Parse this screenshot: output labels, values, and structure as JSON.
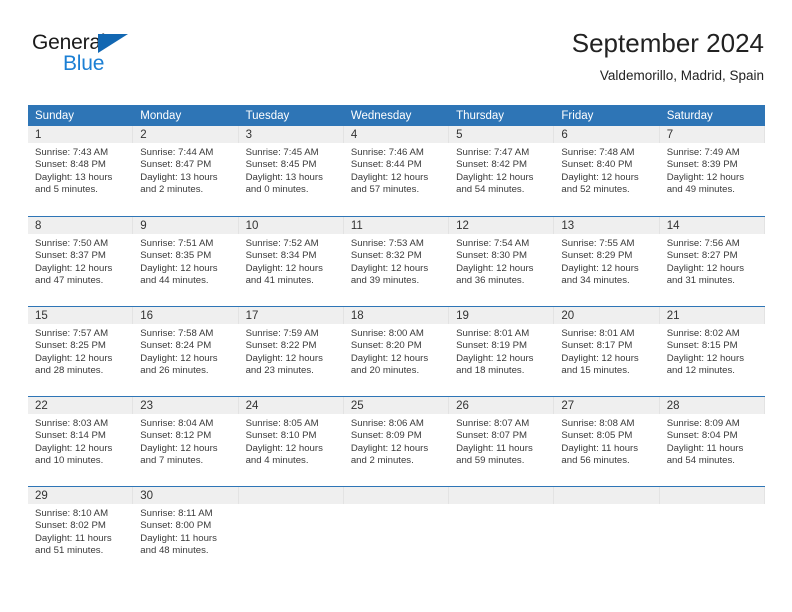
{
  "brand": {
    "name_top": "General",
    "name_bottom": "Blue",
    "flag_icon": "triangle-flag-icon",
    "color_blue": "#1b7fd4",
    "color_flag": "#1267b2"
  },
  "header": {
    "title": "September 2024",
    "subtitle": "Valdemorillo, Madrid, Spain"
  },
  "theme": {
    "header_blue": "#2e75b6",
    "band_gray": "#efefef",
    "text_dark": "#333333"
  },
  "weekday_headers": [
    "Sunday",
    "Monday",
    "Tuesday",
    "Wednesday",
    "Thursday",
    "Friday",
    "Saturday"
  ],
  "weeks": [
    [
      {
        "day": "1",
        "sunrise": "Sunrise: 7:43 AM",
        "sunset": "Sunset: 8:48 PM",
        "daylight_line1": "Daylight: 13 hours",
        "daylight_line2": "and 5 minutes."
      },
      {
        "day": "2",
        "sunrise": "Sunrise: 7:44 AM",
        "sunset": "Sunset: 8:47 PM",
        "daylight_line1": "Daylight: 13 hours",
        "daylight_line2": "and 2 minutes."
      },
      {
        "day": "3",
        "sunrise": "Sunrise: 7:45 AM",
        "sunset": "Sunset: 8:45 PM",
        "daylight_line1": "Daylight: 13 hours",
        "daylight_line2": "and 0 minutes."
      },
      {
        "day": "4",
        "sunrise": "Sunrise: 7:46 AM",
        "sunset": "Sunset: 8:44 PM",
        "daylight_line1": "Daylight: 12 hours",
        "daylight_line2": "and 57 minutes."
      },
      {
        "day": "5",
        "sunrise": "Sunrise: 7:47 AM",
        "sunset": "Sunset: 8:42 PM",
        "daylight_line1": "Daylight: 12 hours",
        "daylight_line2": "and 54 minutes."
      },
      {
        "day": "6",
        "sunrise": "Sunrise: 7:48 AM",
        "sunset": "Sunset: 8:40 PM",
        "daylight_line1": "Daylight: 12 hours",
        "daylight_line2": "and 52 minutes."
      },
      {
        "day": "7",
        "sunrise": "Sunrise: 7:49 AM",
        "sunset": "Sunset: 8:39 PM",
        "daylight_line1": "Daylight: 12 hours",
        "daylight_line2": "and 49 minutes."
      }
    ],
    [
      {
        "day": "8",
        "sunrise": "Sunrise: 7:50 AM",
        "sunset": "Sunset: 8:37 PM",
        "daylight_line1": "Daylight: 12 hours",
        "daylight_line2": "and 47 minutes."
      },
      {
        "day": "9",
        "sunrise": "Sunrise: 7:51 AM",
        "sunset": "Sunset: 8:35 PM",
        "daylight_line1": "Daylight: 12 hours",
        "daylight_line2": "and 44 minutes."
      },
      {
        "day": "10",
        "sunrise": "Sunrise: 7:52 AM",
        "sunset": "Sunset: 8:34 PM",
        "daylight_line1": "Daylight: 12 hours",
        "daylight_line2": "and 41 minutes."
      },
      {
        "day": "11",
        "sunrise": "Sunrise: 7:53 AM",
        "sunset": "Sunset: 8:32 PM",
        "daylight_line1": "Daylight: 12 hours",
        "daylight_line2": "and 39 minutes."
      },
      {
        "day": "12",
        "sunrise": "Sunrise: 7:54 AM",
        "sunset": "Sunset: 8:30 PM",
        "daylight_line1": "Daylight: 12 hours",
        "daylight_line2": "and 36 minutes."
      },
      {
        "day": "13",
        "sunrise": "Sunrise: 7:55 AM",
        "sunset": "Sunset: 8:29 PM",
        "daylight_line1": "Daylight: 12 hours",
        "daylight_line2": "and 34 minutes."
      },
      {
        "day": "14",
        "sunrise": "Sunrise: 7:56 AM",
        "sunset": "Sunset: 8:27 PM",
        "daylight_line1": "Daylight: 12 hours",
        "daylight_line2": "and 31 minutes."
      }
    ],
    [
      {
        "day": "15",
        "sunrise": "Sunrise: 7:57 AM",
        "sunset": "Sunset: 8:25 PM",
        "daylight_line1": "Daylight: 12 hours",
        "daylight_line2": "and 28 minutes."
      },
      {
        "day": "16",
        "sunrise": "Sunrise: 7:58 AM",
        "sunset": "Sunset: 8:24 PM",
        "daylight_line1": "Daylight: 12 hours",
        "daylight_line2": "and 26 minutes."
      },
      {
        "day": "17",
        "sunrise": "Sunrise: 7:59 AM",
        "sunset": "Sunset: 8:22 PM",
        "daylight_line1": "Daylight: 12 hours",
        "daylight_line2": "and 23 minutes."
      },
      {
        "day": "18",
        "sunrise": "Sunrise: 8:00 AM",
        "sunset": "Sunset: 8:20 PM",
        "daylight_line1": "Daylight: 12 hours",
        "daylight_line2": "and 20 minutes."
      },
      {
        "day": "19",
        "sunrise": "Sunrise: 8:01 AM",
        "sunset": "Sunset: 8:19 PM",
        "daylight_line1": "Daylight: 12 hours",
        "daylight_line2": "and 18 minutes."
      },
      {
        "day": "20",
        "sunrise": "Sunrise: 8:01 AM",
        "sunset": "Sunset: 8:17 PM",
        "daylight_line1": "Daylight: 12 hours",
        "daylight_line2": "and 15 minutes."
      },
      {
        "day": "21",
        "sunrise": "Sunrise: 8:02 AM",
        "sunset": "Sunset: 8:15 PM",
        "daylight_line1": "Daylight: 12 hours",
        "daylight_line2": "and 12 minutes."
      }
    ],
    [
      {
        "day": "22",
        "sunrise": "Sunrise: 8:03 AM",
        "sunset": "Sunset: 8:14 PM",
        "daylight_line1": "Daylight: 12 hours",
        "daylight_line2": "and 10 minutes."
      },
      {
        "day": "23",
        "sunrise": "Sunrise: 8:04 AM",
        "sunset": "Sunset: 8:12 PM",
        "daylight_line1": "Daylight: 12 hours",
        "daylight_line2": "and 7 minutes."
      },
      {
        "day": "24",
        "sunrise": "Sunrise: 8:05 AM",
        "sunset": "Sunset: 8:10 PM",
        "daylight_line1": "Daylight: 12 hours",
        "daylight_line2": "and 4 minutes."
      },
      {
        "day": "25",
        "sunrise": "Sunrise: 8:06 AM",
        "sunset": "Sunset: 8:09 PM",
        "daylight_line1": "Daylight: 12 hours",
        "daylight_line2": "and 2 minutes."
      },
      {
        "day": "26",
        "sunrise": "Sunrise: 8:07 AM",
        "sunset": "Sunset: 8:07 PM",
        "daylight_line1": "Daylight: 11 hours",
        "daylight_line2": "and 59 minutes."
      },
      {
        "day": "27",
        "sunrise": "Sunrise: 8:08 AM",
        "sunset": "Sunset: 8:05 PM",
        "daylight_line1": "Daylight: 11 hours",
        "daylight_line2": "and 56 minutes."
      },
      {
        "day": "28",
        "sunrise": "Sunrise: 8:09 AM",
        "sunset": "Sunset: 8:04 PM",
        "daylight_line1": "Daylight: 11 hours",
        "daylight_line2": "and 54 minutes."
      }
    ],
    [
      {
        "day": "29",
        "sunrise": "Sunrise: 8:10 AM",
        "sunset": "Sunset: 8:02 PM",
        "daylight_line1": "Daylight: 11 hours",
        "daylight_line2": "and 51 minutes."
      },
      {
        "day": "30",
        "sunrise": "Sunrise: 8:11 AM",
        "sunset": "Sunset: 8:00 PM",
        "daylight_line1": "Daylight: 11 hours",
        "daylight_line2": "and 48 minutes."
      },
      {
        "day": "",
        "sunrise": "",
        "sunset": "",
        "daylight_line1": "",
        "daylight_line2": ""
      },
      {
        "day": "",
        "sunrise": "",
        "sunset": "",
        "daylight_line1": "",
        "daylight_line2": ""
      },
      {
        "day": "",
        "sunrise": "",
        "sunset": "",
        "daylight_line1": "",
        "daylight_line2": ""
      },
      {
        "day": "",
        "sunrise": "",
        "sunset": "",
        "daylight_line1": "",
        "daylight_line2": ""
      },
      {
        "day": "",
        "sunrise": "",
        "sunset": "",
        "daylight_line1": "",
        "daylight_line2": ""
      }
    ]
  ]
}
